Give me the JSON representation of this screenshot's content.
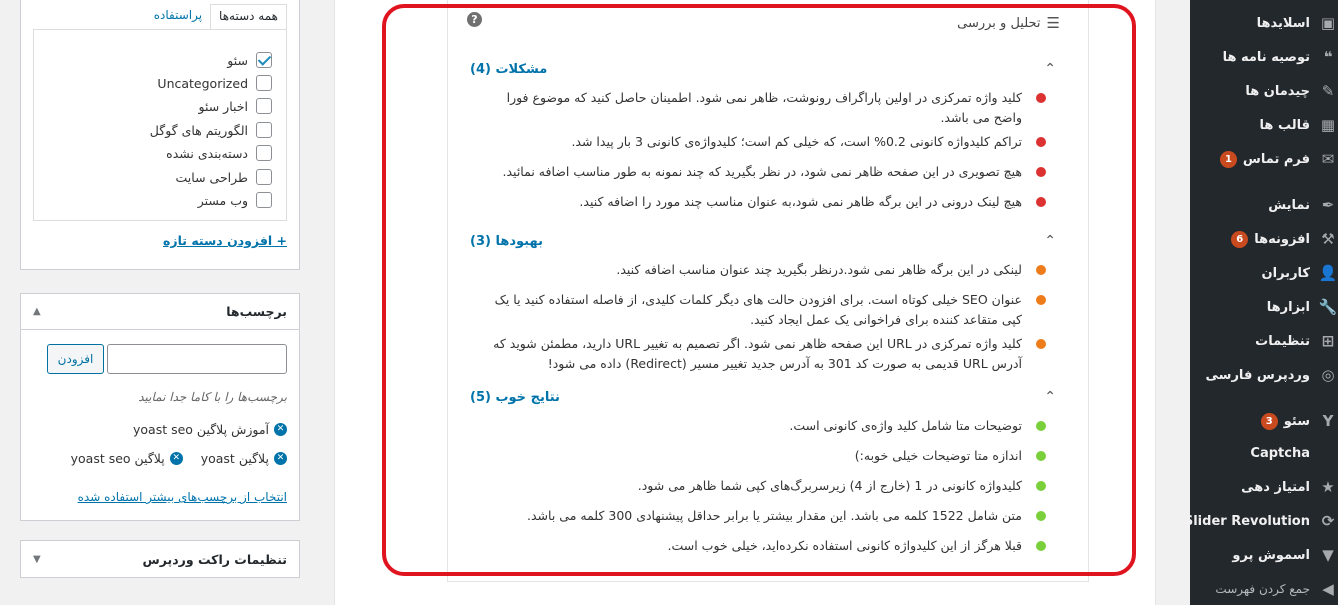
{
  "menu": {
    "items": [
      {
        "label": "اسلایدها",
        "icon": "▣",
        "badge": ""
      },
      {
        "label": "توصیه نامه ها",
        "icon": "❝",
        "badge": ""
      },
      {
        "label": "چیدمان ها",
        "icon": "✎",
        "badge": ""
      },
      {
        "label": "قالب ها",
        "icon": "▦",
        "badge": ""
      },
      {
        "label": "فرم تماس",
        "icon": "✉",
        "badge": "1"
      },
      {
        "label": "نمایش",
        "icon": "✒",
        "badge": ""
      },
      {
        "label": "افزونه‌ها",
        "icon": "⚒",
        "badge": "6"
      },
      {
        "label": "کاربران",
        "icon": "👤",
        "badge": ""
      },
      {
        "label": "ابزارها",
        "icon": "🔧",
        "badge": ""
      },
      {
        "label": "تنظیمات",
        "icon": "⊞",
        "badge": ""
      },
      {
        "label": "وردپرس فارسی",
        "icon": "◎",
        "badge": ""
      },
      {
        "label": "سئو",
        "icon": "Y",
        "badge": "3"
      },
      {
        "label": "Captcha",
        "icon": "",
        "badge": ""
      },
      {
        "label": "امتیاز دهی",
        "icon": "★",
        "badge": ""
      },
      {
        "label": "Slider Revolution",
        "icon": "⟳",
        "badge": ""
      },
      {
        "label": "اسموش پرو",
        "icon": "▼",
        "badge": ""
      },
      {
        "label": "جمع کردن فهرست",
        "icon": "◀",
        "badge": ""
      }
    ]
  },
  "analysis": {
    "title": "تحلیل و بررسی",
    "sections": [
      {
        "title": "مشکلات (4)",
        "items": [
          "کلید واژه تمرکزی در اولین پاراگراف رونوشت، ظاهر نمی شود. اطمینان حاصل کنید که موضوع فورا واضح می باشد.",
          "تراکم کلیدواژه کانونی 0.2% است، که خیلی کم است؛ کلیدواژه‌ی کانونی 3 بار پیدا شد.",
          "هیچ تصویری در این صفحه ظاهر نمی شود، در نظر بگیرید که چند نمونه به طور مناسب اضافه نمائید.",
          "هیچ لینک درونی در این برگه ظاهر نمی شود،به عنوان مناسب چند مورد را اضافه کنید."
        ]
      },
      {
        "title": "بهبودها (3)",
        "items": [
          "لینکی در این برگه ظاهر نمی شود.درنظر بگیرید چند عنوان مناسب اضافه کنید.",
          "عنوان SEO خیلی کوتاه است. برای افزودن حالت های دیگر کلمات کلیدی، از فاصله استفاده کنید یا یک کپی متقاعد کننده برای فراخوانی یک عمل ایجاد کنید.",
          "کلید واژه تمرکزی در URL این صفحه ظاهر نمی شود. اگر تصمیم به تغییر URL دارید، مطمئن شوید که آدرس URL قدیمی به صورت کد 301 به آدرس جدید تغییر مسیر (Redirect) داده می شود!"
        ]
      },
      {
        "title": "نتایج خوب (5)",
        "items": [
          "توضیحات متا شامل کلید واژه‌ی کانونی است.",
          "اندازه متا توضیحات خیلی خوبه:)",
          "کلیدواژه کانونی در 1 (خارج از 4) زیرسربرگ‌های کپی شما ظاهر می شود.",
          "متن شامل 1522 کلمه می باشد. این مقدار بیشتر یا برابر حداقل پیشنهادی 300 کلمه می باشد.",
          "قبلا هرگز از این کلیدواژه کانونی استفاده نکرده‌اید، خیلی خوب است."
        ]
      }
    ]
  },
  "categories": {
    "tab_all": "همه دسته‌ها",
    "tab_popular": "پراستفاده",
    "items": [
      {
        "label": "سئو",
        "checked": true
      },
      {
        "label": "Uncategorized",
        "checked": false
      },
      {
        "label": "اخبار سئو",
        "checked": false
      },
      {
        "label": "الگوریتم های گوگل",
        "checked": false
      },
      {
        "label": "دسته‌بندی نشده",
        "checked": false
      },
      {
        "label": "طراحی سایت",
        "checked": false
      },
      {
        "label": "وب مستر",
        "checked": false
      }
    ],
    "add_new": "+ افزودن دسته تازه"
  },
  "tags": {
    "title": "برچسب‌ها",
    "add_button": "افزودن",
    "input_value": "",
    "hint": "برچسب‌ها را با کاما جدا نمایید",
    "rows": [
      [
        "آموزش پلاگین yoast seo"
      ],
      [
        "پلاگین yoast",
        "پلاگین yoast seo"
      ]
    ],
    "choose_link": "انتخاب از برچسب‌های بیشتر استفاده شده"
  },
  "rocket": {
    "title": "تنظیمات راکت وردپرس"
  }
}
